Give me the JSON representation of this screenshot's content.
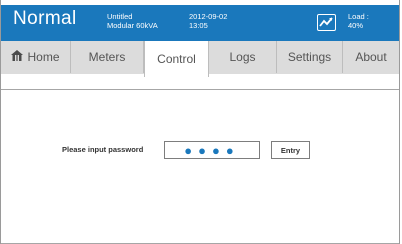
{
  "header": {
    "status": "Normal",
    "device_name": "Untitled",
    "device_model": "Modular 60kVA",
    "date": "2012-09-02",
    "time": "13:05",
    "load_label": "Load :",
    "load_value": "40%",
    "load_icon": "load-graph-icon"
  },
  "tabs": [
    {
      "label": "Home",
      "icon": "home-icon"
    },
    {
      "label": "Meters"
    },
    {
      "label": "Control"
    },
    {
      "label": "Logs"
    },
    {
      "label": "Settings"
    },
    {
      "label": "About"
    }
  ],
  "login": {
    "prompt": "Please input password",
    "password_value": "●●●●",
    "entry_label": "Entry"
  },
  "colors": {
    "header_bg": "#1a78bc",
    "tabbar_bg": "#dcdcdc",
    "active_tab_bg": "#ffffff"
  }
}
